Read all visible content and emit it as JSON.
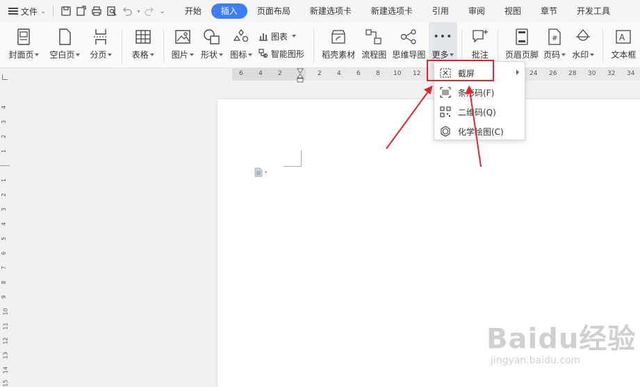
{
  "topbar": {
    "file_label": "文件",
    "tabs": [
      {
        "label": "开始",
        "active": false
      },
      {
        "label": "插入",
        "active": true
      },
      {
        "label": "页面布局",
        "active": false
      },
      {
        "label": "新建选项卡",
        "active": false
      },
      {
        "label": "新建选项卡",
        "active": false
      },
      {
        "label": "引用",
        "active": false
      },
      {
        "label": "审阅",
        "active": false
      },
      {
        "label": "视图",
        "active": false
      },
      {
        "label": "章节",
        "active": false
      },
      {
        "label": "开发工具",
        "active": false
      }
    ]
  },
  "ribbon": {
    "cover_page": "封面页",
    "blank_page": "空白页",
    "page_break": "分页",
    "table": "表格",
    "picture": "图片",
    "shape": "形状",
    "icons": "图标",
    "chart": "图表",
    "smart_art": "智能图形",
    "docer_material": "稻壳素材",
    "flowchart": "流程图",
    "mindmap": "思维导图",
    "more": "更多",
    "comment": "批注",
    "header_footer": "页眉页脚",
    "page_number": "页码",
    "watermark": "水印",
    "textbox": "文本框"
  },
  "ruler": {
    "ticks": [
      "6",
      "4",
      "2",
      "2",
      "4",
      "6",
      "8",
      "10",
      "12",
      "",
      "",
      "",
      "",
      "24",
      "26",
      "28",
      "30",
      "32",
      "34"
    ]
  },
  "vruler": {
    "ticks": [
      "4",
      "3",
      "2",
      "1",
      "1",
      "2",
      "3",
      "4",
      "5",
      "6",
      "7",
      "8",
      "9",
      "10",
      "11",
      "12",
      "13",
      "14",
      "15"
    ]
  },
  "dropdown": {
    "items": [
      {
        "label": "截屏",
        "icon": "screenshot-icon"
      },
      {
        "label": "条形码(F)",
        "icon": "barcode-icon"
      },
      {
        "label": "二维码(Q)",
        "icon": "qrcode-icon"
      },
      {
        "label": "化学绘图(C)",
        "icon": "chemistry-icon"
      }
    ]
  },
  "watermark": {
    "brand": "Baidu经验",
    "url": "jingyan.baidu.com"
  },
  "colors": {
    "accent": "#3d7eff",
    "highlight_box": "#e0262c",
    "arrow": "#e0262c"
  }
}
